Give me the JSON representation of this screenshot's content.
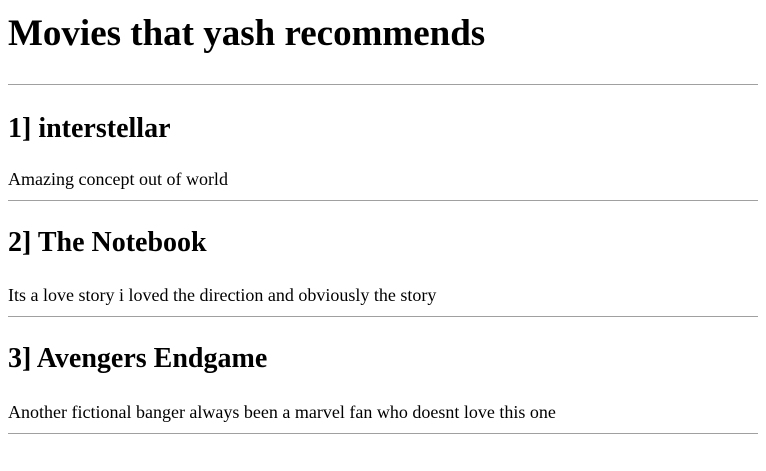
{
  "page": {
    "title": "Movies that yash recommends"
  },
  "movies": [
    {
      "heading": "1] interstellar",
      "description": "Amazing concept out of world"
    },
    {
      "heading": "2] The Notebook",
      "description": "Its a love story i loved the direction and obviously the story"
    },
    {
      "heading": "3] Avengers Endgame",
      "description": "Another fictional banger always been a marvel fan who doesnt love this one"
    }
  ]
}
